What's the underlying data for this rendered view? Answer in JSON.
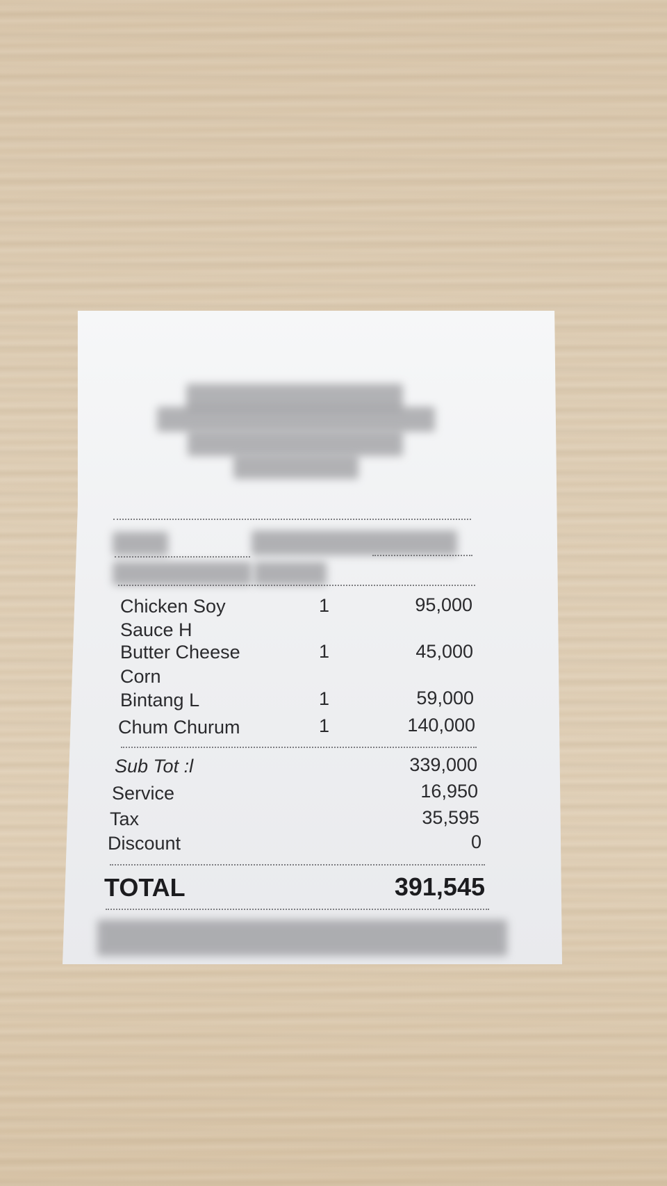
{
  "items": [
    {
      "name_line1": "Chicken Soy",
      "name_line2": "Sauce H",
      "qty": "1",
      "price": "95,000"
    },
    {
      "name_line1": "Butter Cheese",
      "name_line2": "Corn",
      "qty": "1",
      "price": "45,000"
    },
    {
      "name_line1": "Bintang L",
      "name_line2": "",
      "qty": "1",
      "price": "59,000"
    },
    {
      "name_line1": "Chum Churum",
      "name_line2": "",
      "qty": "1",
      "price": "140,000"
    }
  ],
  "summary": {
    "subtotal_label": "Sub Tot :l",
    "subtotal_value": "339,000",
    "service_label": "Service",
    "service_value": "16,950",
    "tax_label": "Tax",
    "tax_value": "35,595",
    "discount_label": "Discount",
    "discount_value": "0"
  },
  "total": {
    "label": "TOTAL",
    "value": "391,545"
  },
  "colors": {
    "paper": "#f2f3f5",
    "ink": "#2a2a2d",
    "table": "#ddcbb1"
  }
}
